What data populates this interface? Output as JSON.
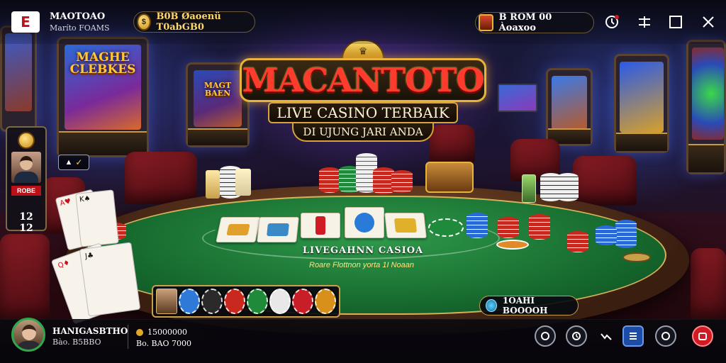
{
  "app": {
    "badge": "E",
    "title": "MAOTOAO",
    "subtitle": "Maríto FOAMS"
  },
  "header_pills": {
    "left": {
      "coin": "$",
      "text": "B0B Øaoenü T0abGB0"
    },
    "right": {
      "text": "B ROM 00 Àoaxoo"
    }
  },
  "logo": {
    "crown": "♛",
    "main": "MACANTOTO",
    "line1": "LIVE CASINO TERBAIK",
    "line2": "DI UJUNG JARI ANDA"
  },
  "slot_titles": {
    "left": "MAGHE CLEBKES",
    "mid": "MAGT BAEN"
  },
  "player_card": {
    "tag": "ROBE",
    "bet": "12 12"
  },
  "side_label": {
    "icon": "▲",
    "text": "✓"
  },
  "felt": {
    "title": "LIVEGAHNN CASIOA",
    "subtitle": "Roare Flottnon yorta 1I Noaan"
  },
  "balance": {
    "text": "1OAHI BOOOOH"
  },
  "bottom": {
    "name": "HANIGASBTHO",
    "sub": "Bào. B5BBO",
    "stat1": "15000000",
    "stat2": "Bo. BAO 7000"
  },
  "selector_chips": [
    {
      "color": "#2f7ad8"
    },
    {
      "color": "#2a2a2a"
    },
    {
      "color": "#c8281e"
    },
    {
      "color": "#1e8a3a"
    },
    {
      "color": "#e8e8e8"
    },
    {
      "color": "#c81e28"
    },
    {
      "color": "#d8901a"
    }
  ],
  "colors": {
    "accent_gold": "#e8b33a",
    "logo_red": "#ff3b2e",
    "felt_green": "#1e7a36",
    "chair_red": "#8a1c24"
  },
  "icons": {
    "top": [
      "settings-icon",
      "split-screen-icon",
      "maximize-icon",
      "close-icon"
    ],
    "bottom": [
      "chat-icon",
      "history-icon",
      "stats-icon",
      "menu-icon",
      "info-icon",
      "exit-icon"
    ]
  }
}
